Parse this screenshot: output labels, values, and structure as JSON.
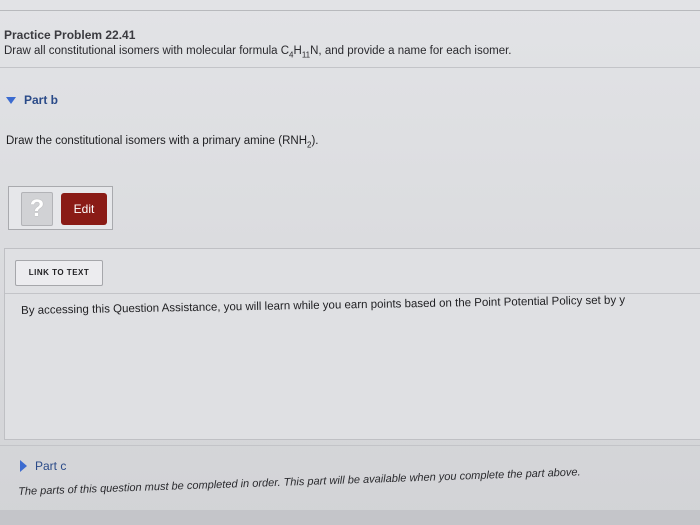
{
  "problem": {
    "title": "Practice Problem 22.41",
    "prompt_before": "Draw all constitutional isomers with molecular formula C",
    "sub_c": "4",
    "mid_h": "H",
    "sub_h": "11",
    "prompt_after": "N, and provide a name for each isomer."
  },
  "part_b": {
    "label": "Part b",
    "instruction_before": "Draw the constitutional isomers with a primary amine (RNH",
    "sub_2": "2",
    "instruction_after": ")."
  },
  "tools": {
    "help_label": "?",
    "edit_label": "Edit"
  },
  "assistance": {
    "link_label": "LINK TO TEXT",
    "text": "By accessing this Question Assistance, you will learn while you earn points based on the Point Potential Policy set by y"
  },
  "part_c": {
    "label": "Part c",
    "note": "The parts of this question must be completed in order. This part will be available when you complete the part above."
  },
  "colors": {
    "edit_button": "#8a1b16",
    "part_triangle": "#3c6bd0",
    "part_label": "#2a4a88"
  }
}
